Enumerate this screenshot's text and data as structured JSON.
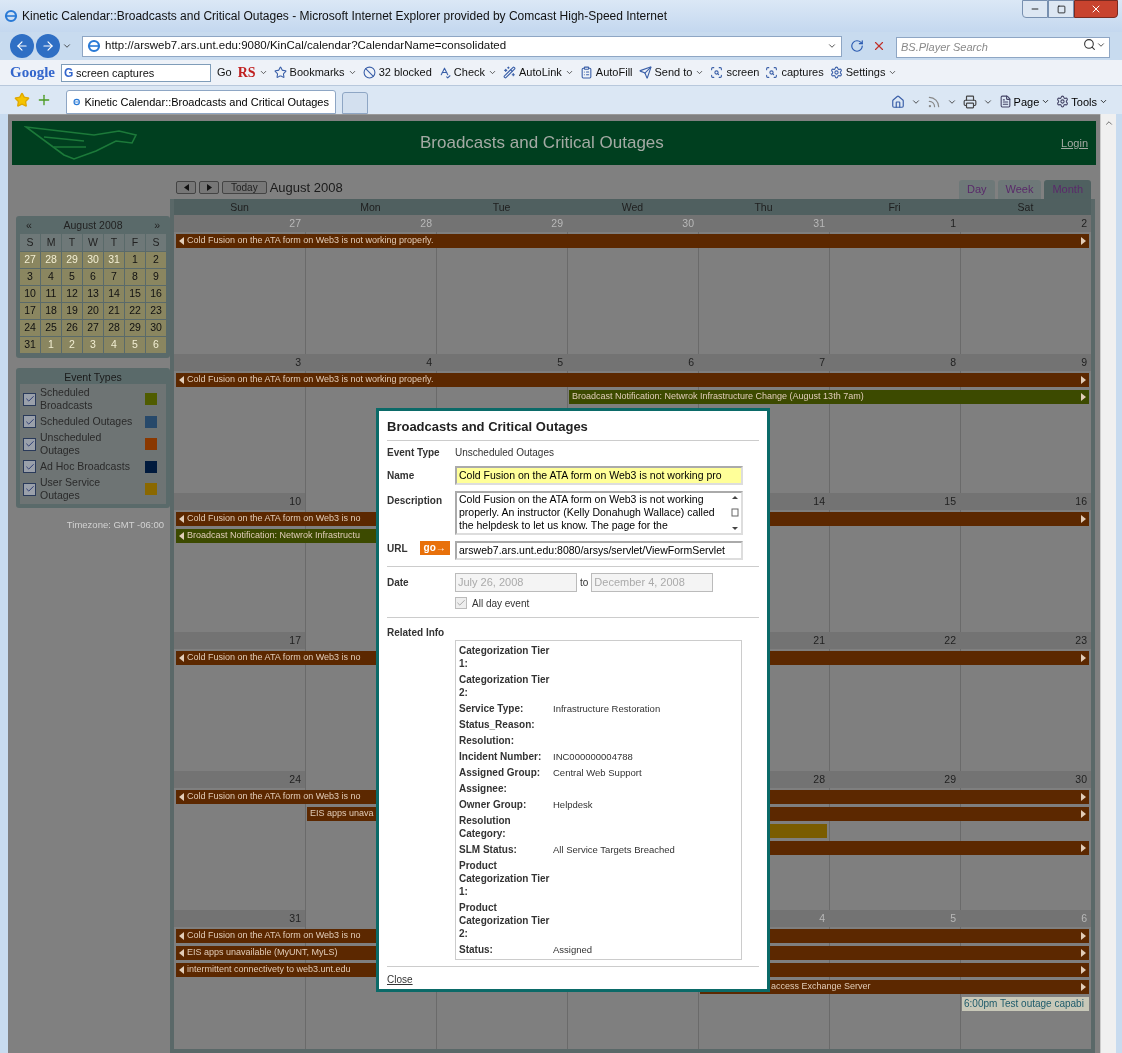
{
  "window": {
    "title": "Kinetic Calendar::Broadcasts and Critical Outages - Microsoft Internet Explorer provided by Comcast High-Speed Internet"
  },
  "address_bar": {
    "url": "http://arsweb7.ars.unt.edu:9080/KinCal/calendar?CalendarName=consolidated",
    "search_placeholder": "BS.Player Search"
  },
  "google_toolbar": {
    "logo": "Google",
    "engine_mark": "G",
    "query": "screen captures",
    "go": "Go",
    "items": [
      {
        "label": "RS",
        "kind": "menu"
      },
      {
        "label": "Bookmarks",
        "kind": "menu"
      },
      {
        "label": "32 blocked",
        "kind": "button"
      },
      {
        "label": "Check",
        "kind": "menu"
      },
      {
        "label": "AutoLink",
        "kind": "menu"
      },
      {
        "label": "AutoFill",
        "kind": "button"
      },
      {
        "label": "Send to",
        "kind": "menu"
      },
      {
        "label": "screen",
        "kind": "button"
      },
      {
        "label": "captures",
        "kind": "button"
      },
      {
        "label": "Settings",
        "kind": "menu"
      }
    ]
  },
  "tab_bar": {
    "tabs": [
      {
        "label": "Kinetic Calendar::Broadcasts and Critical Outages",
        "selected": true
      }
    ],
    "commands": [
      "Page",
      "Tools"
    ]
  },
  "header": {
    "title": "Broadcasts and Critical Outages",
    "login": "Login"
  },
  "nav": {
    "today": "Today",
    "month": "August 2008"
  },
  "views": [
    {
      "label": "Day",
      "selected": false
    },
    {
      "label": "Week",
      "selected": false
    },
    {
      "label": "Month",
      "selected": true
    }
  ],
  "weekdays": [
    "Sun",
    "Mon",
    "Tue",
    "Wed",
    "Thu",
    "Fri",
    "Sat"
  ],
  "mini_calendar": {
    "title": "August 2008",
    "prev": "«",
    "next": "»",
    "weekday_letters": [
      "S",
      "M",
      "T",
      "W",
      "T",
      "F",
      "S"
    ],
    "weeks": [
      [
        {
          "day": "27",
          "other_month": true
        },
        {
          "day": "28",
          "other_month": true
        },
        {
          "day": "29",
          "other_month": true
        },
        {
          "day": "30",
          "other_month": true
        },
        {
          "day": "31",
          "other_month": true
        },
        {
          "day": "1",
          "other_month": false
        },
        {
          "day": "2",
          "other_month": false
        }
      ],
      [
        {
          "day": "3",
          "other_month": false
        },
        {
          "day": "4",
          "other_month": false
        },
        {
          "day": "5",
          "other_month": false
        },
        {
          "day": "6",
          "other_month": false
        },
        {
          "day": "7",
          "other_month": false
        },
        {
          "day": "8",
          "other_month": false
        },
        {
          "day": "9",
          "other_month": false
        }
      ],
      [
        {
          "day": "10",
          "other_month": false
        },
        {
          "day": "11",
          "other_month": false
        },
        {
          "day": "12",
          "other_month": false
        },
        {
          "day": "13",
          "other_month": false
        },
        {
          "day": "14",
          "other_month": false
        },
        {
          "day": "15",
          "other_month": false
        },
        {
          "day": "16",
          "other_month": false
        }
      ],
      [
        {
          "day": "17",
          "other_month": false
        },
        {
          "day": "18",
          "other_month": false
        },
        {
          "day": "19",
          "other_month": false
        },
        {
          "day": "20",
          "other_month": false
        },
        {
          "day": "21",
          "other_month": false
        },
        {
          "day": "22",
          "other_month": false
        },
        {
          "day": "23",
          "other_month": false
        }
      ],
      [
        {
          "day": "24",
          "other_month": false
        },
        {
          "day": "25",
          "other_month": false
        },
        {
          "day": "26",
          "other_month": false
        },
        {
          "day": "27",
          "other_month": false
        },
        {
          "day": "28",
          "other_month": false
        },
        {
          "day": "29",
          "other_month": false
        },
        {
          "day": "30",
          "other_month": false
        }
      ],
      [
        {
          "day": "31",
          "other_month": false
        },
        {
          "day": "1",
          "other_month": true
        },
        {
          "day": "2",
          "other_month": true
        },
        {
          "day": "3",
          "other_month": true
        },
        {
          "day": "4",
          "other_month": true
        },
        {
          "day": "5",
          "other_month": true
        },
        {
          "day": "6",
          "other_month": true
        }
      ]
    ]
  },
  "event_types": {
    "title": "Event Types",
    "items": [
      {
        "label": "Scheduled Broadcasts",
        "checked": true,
        "color": "#4f5c00"
      },
      {
        "label": "Scheduled Outages",
        "checked": true,
        "color": "#27496a"
      },
      {
        "label": "Unscheduled Outages",
        "checked": true,
        "color": "#8a3800"
      },
      {
        "label": "Ad Hoc Broadcasts",
        "checked": true,
        "color": "#001a3d"
      },
      {
        "label": "User Service Outages",
        "checked": true,
        "color": "#8a6800"
      }
    ]
  },
  "timezone": "Timezone: GMT -06:00",
  "weeks": [
    {
      "days": [
        {
          "kind": "date",
          "date": "27",
          "other_month": true
        },
        {
          "kind": "date",
          "date": "28",
          "other_month": true
        },
        {
          "kind": "date",
          "date": "29",
          "other_month": true
        },
        {
          "kind": "date",
          "date": "30",
          "other_month": true
        },
        {
          "kind": "date",
          "date": "31",
          "other_month": true
        },
        {
          "kind": "date",
          "date": "1",
          "other_month": false
        },
        {
          "kind": "date",
          "date": "2",
          "other_month": false
        }
      ],
      "lanes": [
        [
          {
            "kind": "bar",
            "color": "#5c2800",
            "continues_before": true,
            "continues_after": true,
            "text": "Cold Fusion on the ATA form on Web3 is not working properly."
          },
          {
            "kind": "covered"
          },
          {
            "kind": "covered"
          },
          {
            "kind": "covered"
          },
          {
            "kind": "covered"
          },
          {
            "kind": "covered"
          },
          {
            "kind": "covered"
          }
        ]
      ]
    },
    {
      "days": [
        {
          "kind": "date",
          "date": "3",
          "other_month": false
        },
        {
          "kind": "date",
          "date": "4",
          "other_month": false
        },
        {
          "kind": "date",
          "date": "5",
          "other_month": false
        },
        {
          "kind": "date",
          "date": "6",
          "other_month": false
        },
        {
          "kind": "date",
          "date": "7",
          "other_month": false
        },
        {
          "kind": "date",
          "date": "8",
          "other_month": false
        },
        {
          "kind": "date",
          "date": "9",
          "other_month": false
        }
      ],
      "lanes": [
        [
          {
            "kind": "bar",
            "color": "#5c2800",
            "continues_before": true,
            "continues_after": true,
            "text": "Cold Fusion on the ATA form on Web3 is not working properly."
          },
          {
            "kind": "covered"
          },
          {
            "kind": "covered"
          },
          {
            "kind": "covered"
          },
          {
            "kind": "covered"
          },
          {
            "kind": "covered"
          },
          {
            "kind": "covered"
          }
        ],
        [
          {
            "kind": "blank"
          },
          {
            "kind": "blank"
          },
          {
            "kind": "blank"
          },
          {
            "kind": "bar",
            "color": "#3c4a00",
            "continues_before": false,
            "continues_after": true,
            "text": "Broadcast Notification: Netwrok Infrastructure Change (August 13th 7am)"
          },
          {
            "kind": "covered"
          },
          {
            "kind": "covered"
          },
          {
            "kind": "covered"
          }
        ]
      ]
    },
    {
      "days": [
        {
          "kind": "date",
          "date": "10",
          "other_month": false
        },
        {
          "kind": "hidden"
        },
        {
          "kind": "hidden"
        },
        {
          "kind": "hidden"
        },
        {
          "kind": "date",
          "date": "14",
          "other_month": false
        },
        {
          "kind": "date",
          "date": "15",
          "other_month": false
        },
        {
          "kind": "date",
          "date": "16",
          "other_month": false
        }
      ],
      "lanes": [
        [
          {
            "kind": "bar",
            "color": "#5c2800",
            "continues_before": true,
            "continues_after": true,
            "text": "Cold Fusion on the ATA form on Web3 is no"
          },
          {
            "kind": "covered"
          },
          {
            "kind": "covered"
          },
          {
            "kind": "covered"
          },
          {
            "kind": "covered"
          },
          {
            "kind": "covered"
          },
          {
            "kind": "covered"
          }
        ],
        [
          {
            "kind": "bar",
            "color": "#3c4a00",
            "continues_before": true,
            "continues_after": false,
            "text": "Broadcast Notification: Netwrok Infrastructu"
          },
          {
            "kind": "covered"
          },
          {
            "kind": "covered"
          },
          {
            "kind": "covered"
          }
        ]
      ]
    },
    {
      "days": [
        {
          "kind": "date",
          "date": "17",
          "other_month": false
        },
        {
          "kind": "hidden"
        },
        {
          "kind": "hidden"
        },
        {
          "kind": "hidden"
        },
        {
          "kind": "date",
          "date": "21",
          "other_month": false
        },
        {
          "kind": "date",
          "date": "22",
          "other_month": false
        },
        {
          "kind": "date",
          "date": "23",
          "other_month": false
        }
      ],
      "lanes": [
        [
          {
            "kind": "bar",
            "color": "#5c2800",
            "continues_before": true,
            "continues_after": true,
            "text": "Cold Fusion on the ATA form on Web3 is no"
          },
          {
            "kind": "covered"
          },
          {
            "kind": "covered"
          },
          {
            "kind": "covered"
          },
          {
            "kind": "covered"
          },
          {
            "kind": "covered"
          },
          {
            "kind": "covered"
          }
        ]
      ]
    },
    {
      "days": [
        {
          "kind": "date",
          "date": "24",
          "other_month": false
        },
        {
          "kind": "hidden"
        },
        {
          "kind": "hidden"
        },
        {
          "kind": "hidden"
        },
        {
          "kind": "date",
          "date": "28",
          "other_month": false
        },
        {
          "kind": "date",
          "date": "29",
          "other_month": false
        },
        {
          "kind": "date",
          "date": "30",
          "other_month": false
        }
      ],
      "lanes": [
        [
          {
            "kind": "bar",
            "color": "#5c2800",
            "continues_before": true,
            "continues_after": true,
            "text": "Cold Fusion on the ATA form on Web3 is no"
          },
          {
            "kind": "covered"
          },
          {
            "kind": "covered"
          },
          {
            "kind": "covered"
          },
          {
            "kind": "covered"
          },
          {
            "kind": "covered"
          },
          {
            "kind": "covered"
          }
        ],
        [
          {
            "kind": "blank"
          },
          {
            "kind": "bar",
            "color": "#5c2800",
            "continues_before": false,
            "continues_after": true,
            "text": "EIS apps unava"
          },
          {
            "kind": "covered"
          },
          {
            "kind": "covered"
          },
          {
            "kind": "covered"
          },
          {
            "kind": "covered"
          },
          {
            "kind": "covered"
          }
        ],
        [
          {
            "kind": "blank"
          },
          {
            "kind": "blank"
          },
          {
            "kind": "blank"
          },
          {
            "kind": "bar",
            "color": "#7a5c00",
            "continues_before": false,
            "continues_after": false
          },
          {
            "kind": "covered"
          }
        ],
        [
          {
            "kind": "blank"
          },
          {
            "kind": "blank"
          },
          {
            "kind": "blank"
          },
          {
            "kind": "bar",
            "color": "#5c2800",
            "continues_before": false,
            "continues_after": true
          },
          {
            "kind": "covered"
          },
          {
            "kind": "covered"
          },
          {
            "kind": "covered"
          }
        ]
      ]
    },
    {
      "days": [
        {
          "kind": "date",
          "date": "31",
          "other_month": false
        },
        {
          "kind": "hidden"
        },
        {
          "kind": "hidden"
        },
        {
          "kind": "hidden"
        },
        {
          "kind": "date",
          "date": "4",
          "other_month": true
        },
        {
          "kind": "date",
          "date": "5",
          "other_month": true
        },
        {
          "kind": "date",
          "date": "6",
          "other_month": true
        }
      ],
      "lanes": [
        [
          {
            "kind": "bar",
            "color": "#5c2800",
            "continues_before": true,
            "continues_after": true,
            "text": "Cold Fusion on the ATA form on Web3 is no"
          },
          {
            "kind": "covered"
          },
          {
            "kind": "covered"
          },
          {
            "kind": "covered"
          },
          {
            "kind": "covered"
          },
          {
            "kind": "covered"
          },
          {
            "kind": "covered"
          }
        ],
        [
          {
            "kind": "bar",
            "color": "#5c2800",
            "continues_before": true,
            "continues_after": true,
            "text": "EIS apps unavailable (MyUNT, MyLS)"
          },
          {
            "kind": "covered"
          },
          {
            "kind": "covered"
          },
          {
            "kind": "covered"
          },
          {
            "kind": "covered"
          },
          {
            "kind": "covered"
          },
          {
            "kind": "covered"
          }
        ],
        [
          {
            "kind": "bar",
            "color": "#5c2800",
            "continues_before": true,
            "continues_after": true,
            "text": "intermittent connectivety to web3.unt.edu"
          },
          {
            "kind": "covered"
          },
          {
            "kind": "covered"
          },
          {
            "kind": "covered"
          },
          {
            "kind": "covered"
          },
          {
            "kind": "covered"
          },
          {
            "kind": "covered"
          }
        ],
        [
          {
            "kind": "blank"
          },
          {
            "kind": "blank"
          },
          {
            "kind": "blank"
          },
          {
            "kind": "blank"
          },
          {
            "kind": "bar_hidden_start",
            "color": "#5c2800",
            "continues_before": false,
            "continues_after": true,
            "text": "access Exchange Server"
          },
          {
            "kind": "covered"
          },
          {
            "kind": "covered"
          }
        ],
        [
          {
            "kind": "blank"
          },
          {
            "kind": "blank"
          },
          {
            "kind": "blank"
          },
          {
            "kind": "blank"
          },
          {
            "kind": "blank"
          },
          {
            "kind": "blank"
          },
          {
            "kind": "timed",
            "color": "#c8c8b8",
            "text": "6:00pm Test outage capabi"
          }
        ]
      ]
    }
  ],
  "dialog": {
    "title": "Broadcasts and Critical Outages",
    "event_type_label": "Event Type",
    "event_type": "Unscheduled Outages",
    "name_label": "Name",
    "name": "Cold Fusion on the ATA form on Web3 is not working pro",
    "description_label": "Description",
    "description": "Cold Fusion on the ATA form on Web3 is not working properly.  An instructor (Kelly Donahugh Wallace) called the helpdesk to let us know.  The page for the",
    "url_label": "URL",
    "go": "go→",
    "url": "arsweb7.ars.unt.edu:8080/arsys/servlet/ViewFormServlet",
    "date_label": "Date",
    "start_date": "July 26, 2008",
    "to": "to",
    "end_date": "December 4, 2008",
    "all_day": {
      "label": "All day event",
      "checked": true,
      "disabled": true
    },
    "related_label": "Related Info",
    "related": [
      {
        "label": "Categorization Tier 1:"
      },
      {
        "label": "Categorization Tier 2:"
      },
      {
        "label": "Service Type:",
        "value": "Infrastructure Restoration"
      },
      {
        "label": "Status_Reason:"
      },
      {
        "label": "Resolution:"
      },
      {
        "label": "Incident Number:",
        "value": "INC000000004788"
      },
      {
        "label": "Assigned Group:",
        "value": "Central Web Support"
      },
      {
        "label": "Assignee:"
      },
      {
        "label": "Owner Group:",
        "value": "Helpdesk"
      },
      {
        "label": "Resolution Category:"
      },
      {
        "label": "SLM Status:",
        "value": "All Service Targets Breached"
      },
      {
        "label": "Product Categorization Tier 1:"
      },
      {
        "label": "Product Categorization Tier 2:"
      },
      {
        "label": "Status:",
        "value": "Assigned"
      }
    ],
    "close": "Close"
  }
}
